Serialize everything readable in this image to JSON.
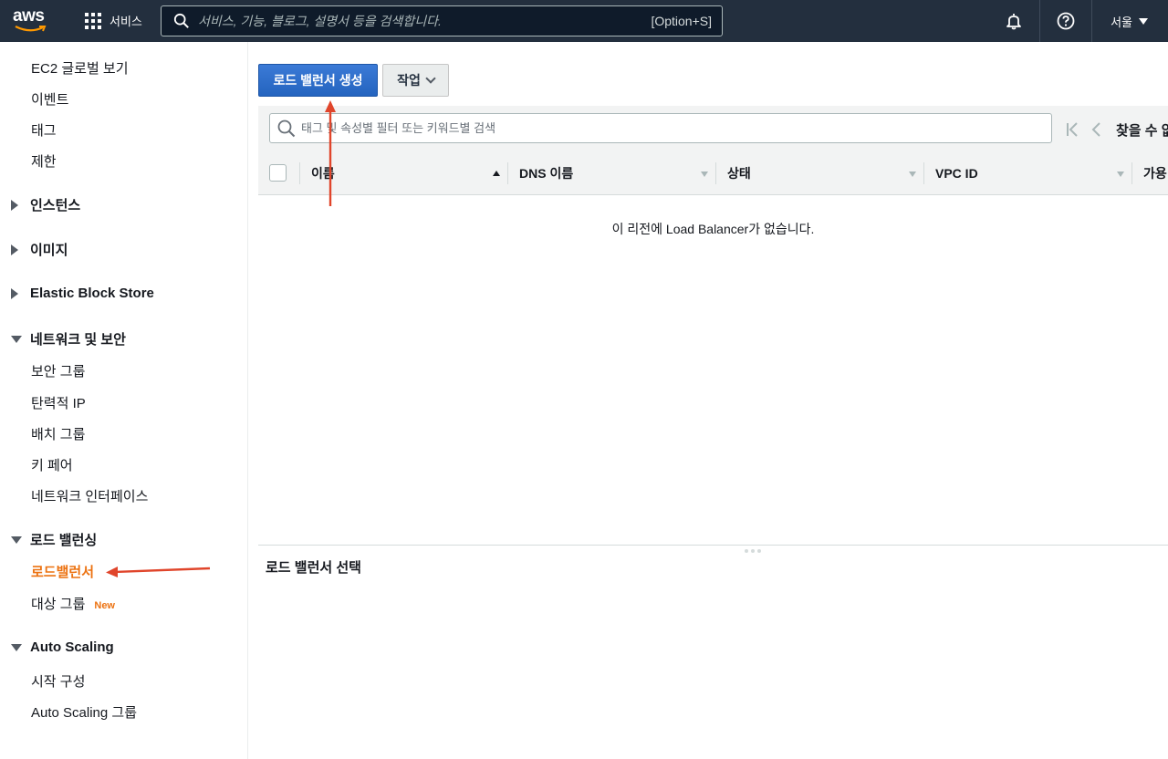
{
  "topnav": {
    "logo_text": "aws",
    "services_label": "서비스",
    "search_placeholder": "서비스, 기능, 블로그, 설명서 등을 검색합니다.",
    "search_shortcut": "[Option+S]",
    "region_label": "서울"
  },
  "sidebar": {
    "links_top": [
      "EC2 글로벌 보기",
      "이벤트",
      "태그",
      "제한"
    ],
    "section_instances": "인스턴스",
    "section_images": "이미지",
    "section_ebs": "Elastic Block Store",
    "section_network": "네트워크 및 보안",
    "network_items": [
      "보안 그룹",
      "탄력적 IP",
      "배치 그룹",
      "키 페어",
      "네트워크 인터페이스"
    ],
    "section_lb": "로드 밸런싱",
    "lb_items": [
      "로드밸런서",
      "대상 그룹"
    ],
    "new_badge": "New",
    "section_autoscaling": "Auto Scaling",
    "autoscaling_items": [
      "시작 구성",
      "Auto Scaling 그룹"
    ]
  },
  "main": {
    "create_button": "로드 밸런서 생성",
    "actions_button": "작업",
    "filter_placeholder": "태그 및 속성별 필터 또는 키워드별 검색",
    "pager_text": "찾을 수 없",
    "columns": [
      "이름",
      "DNS 이름",
      "상태",
      "VPC ID",
      "가용"
    ],
    "empty_message": "이 리전에 Load Balancer가 없습니다.",
    "detail_title": "로드 밸런서 선택"
  },
  "colors": {
    "nav_bg": "#232f3e",
    "primary_button": "#2f6bc4",
    "active_link": "#ec7211",
    "annotation_arrow": "#e0452b"
  }
}
